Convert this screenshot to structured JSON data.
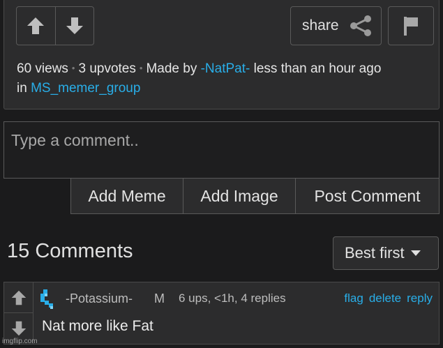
{
  "post": {
    "share_label": "share",
    "views": "60 views",
    "upvotes": "3 upvotes",
    "made_by_prefix": "Made by",
    "author": "-NatPat-",
    "time": "less than an hour ago",
    "in_prefix": "in",
    "group": "MS_memer_group",
    "icons": [
      "arrow-up-icon",
      "arrow-down-icon",
      "share-icon",
      "flag-icon"
    ]
  },
  "composer": {
    "placeholder": "Type a comment..",
    "add_meme": "Add Meme",
    "add_image": "Add Image",
    "post_comment": "Post Comment"
  },
  "comments_header": {
    "count_label": "15 Comments",
    "sort_selected": "Best first"
  },
  "comments": [
    {
      "author": "-Potassium-",
      "gender": "M",
      "stats": "6 ups, <1h, 4 replies",
      "flag": "flag",
      "delete": "delete",
      "reply": "reply",
      "text": "Nat more like Fat"
    }
  ],
  "watermark": "imgflip.com",
  "colors": {
    "background": "#1b1b1c",
    "panel": "#2c2c2d",
    "link": "#29aee8",
    "avatar": "#29aee8"
  }
}
